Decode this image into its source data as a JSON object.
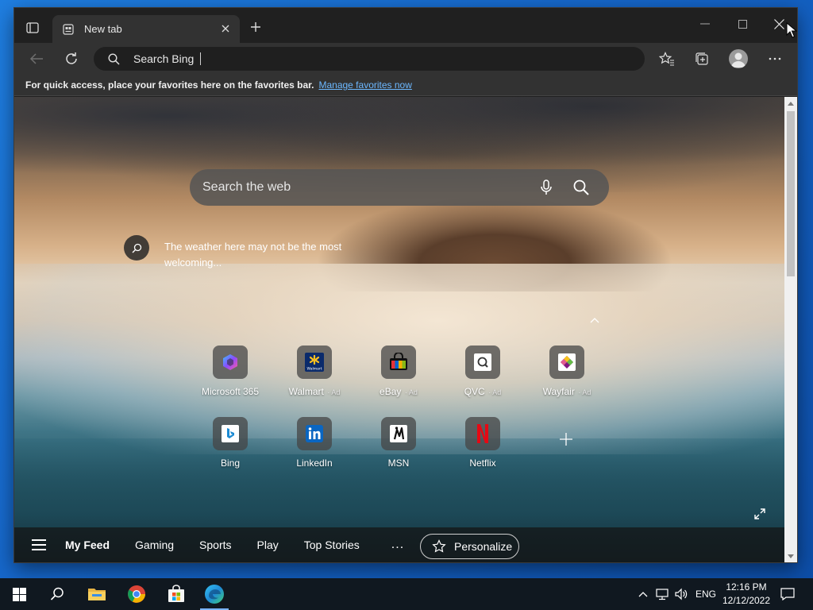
{
  "browser": {
    "tab": {
      "title": "New tab"
    },
    "address_bar": {
      "text": "Search Bing"
    },
    "favorites_bar": {
      "message": "For quick access, place your favorites here on the favorites bar.",
      "link": "Manage favorites now"
    }
  },
  "newtab": {
    "search": {
      "placeholder": "Search the web"
    },
    "weather": {
      "text": "The weather here may not be the most welcoming..."
    },
    "ad_badge": "Ad",
    "tiles_row1": [
      {
        "label": "Microsoft 365",
        "ad": false,
        "icon": "microsoft-365-icon"
      },
      {
        "label": "Walmart",
        "ad": true,
        "icon": "walmart-icon"
      },
      {
        "label": "eBay",
        "ad": true,
        "icon": "ebay-icon"
      },
      {
        "label": "QVC",
        "ad": true,
        "icon": "qvc-icon"
      },
      {
        "label": "Wayfair",
        "ad": true,
        "icon": "wayfair-icon"
      }
    ],
    "tiles_row2": [
      {
        "label": "Bing",
        "ad": false,
        "icon": "bing-icon"
      },
      {
        "label": "LinkedIn",
        "ad": false,
        "icon": "linkedin-icon"
      },
      {
        "label": "MSN",
        "ad": false,
        "icon": "msn-icon"
      },
      {
        "label": "Netflix",
        "ad": false,
        "icon": "netflix-icon"
      }
    ],
    "walmart_logo_text": "Walmart",
    "feed": {
      "items": [
        "My Feed",
        "Gaming",
        "Sports",
        "Play",
        "Top Stories"
      ],
      "more": "...",
      "personalize": "Personalize"
    }
  },
  "taskbar": {
    "language": "ENG",
    "time": "12:16 PM",
    "date": "12/12/2022"
  }
}
